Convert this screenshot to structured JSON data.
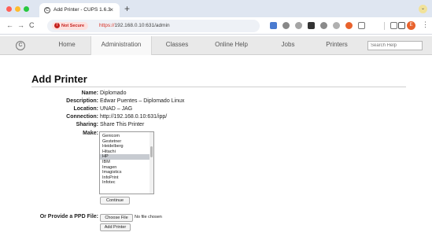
{
  "browser": {
    "tab_title": "Add Printer - CUPS 1.6.3",
    "tab_close": "×",
    "new_tab": "+",
    "tab_menu_icon": "chevron-down-icon",
    "security_label": "Not Secure",
    "url_scheme": "https://",
    "url_rest": "192.168.0.10:631/admin",
    "nav_icons": [
      "back-arrow-icon",
      "forward-arrow-icon",
      "reload-icon"
    ],
    "nav_glyphs": [
      "←",
      "→",
      "C"
    ],
    "profile_initial": "E",
    "menu_glyph": "⋮",
    "star_glyph": "☆",
    "extension_colors": [
      "#4a7bd0",
      "#888888",
      "#a5a5a5",
      "#333333",
      "#8a8a8a",
      "#b0b0b0",
      "#e8622c",
      "#7a7a7a",
      "#7a7a7a",
      "#555555"
    ]
  },
  "cups_nav": {
    "logo_glyph": "C",
    "items": [
      "Home",
      "Administration",
      "Classes",
      "Online Help",
      "Jobs",
      "Printers"
    ],
    "active_item": "Administration",
    "search_placeholder": "Search Help"
  },
  "page": {
    "title": "Add Printer",
    "fields": [
      {
        "label": "Name:",
        "value": "Diplomado"
      },
      {
        "label": "Description:",
        "value": "Edwar Puentes – Diplomado Linux"
      },
      {
        "label": "Location:",
        "value": "UNAD – JAG"
      },
      {
        "label": "Connection:",
        "value": "http://192.168.0.10:631/ipp/"
      },
      {
        "label": "Sharing:",
        "value": "Share This Printer"
      }
    ],
    "make_label": "Make:",
    "make_options": [
      "Genicom",
      "Gestetner",
      "Heidelberg",
      "Hitachi",
      "HP",
      "IBM",
      "Imagen",
      "Imagistics",
      "InfoPrint",
      "Infotec"
    ],
    "make_selected": "HP",
    "continue_button": "Continue",
    "ppd_label": "Or Provide a PPD File:",
    "choose_file_button": "Choose File",
    "no_file_text": "No file chosen",
    "add_printer_button": "Add Printer"
  },
  "colors": {
    "security_red": "#c5221f",
    "tab_strip": "#dfe6f1",
    "cups_nav_bg": "#e9e9e9",
    "selected_option": "#c7cbd1"
  }
}
